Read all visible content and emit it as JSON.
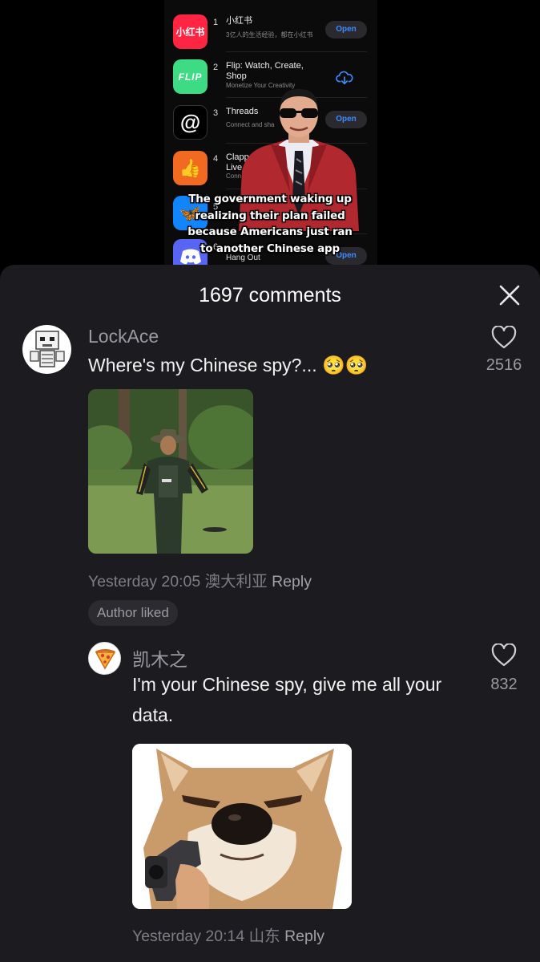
{
  "video": {
    "apps": [
      {
        "rank": "1",
        "name": "小红书",
        "subtitle": "3亿人的生活经验，都在小红书",
        "icon_text": "小红书",
        "icon_color": "#ff2442",
        "action": "Open"
      },
      {
        "rank": "2",
        "name": "Flip: Watch, Create, Shop",
        "subtitle": "Monetize Your Creativity",
        "icon_text": "FLIP",
        "icon_color": "#3ddc84",
        "action": "download-icon"
      },
      {
        "rank": "3",
        "name": "Threads",
        "subtitle": "Connect and sha",
        "icon_text": "@",
        "icon_color": "#000000",
        "action": "Open"
      },
      {
        "rank": "4",
        "name": "Clapp",
        "name2": "Live",
        "subtitle": "Conn",
        "icon_text": "👍",
        "icon_color": "#f26a22",
        "action": ""
      },
      {
        "rank": "5",
        "name": "",
        "subtitle": "",
        "icon_text": "🦋",
        "icon_color": "#1185fe",
        "action": ""
      },
      {
        "rank": "6",
        "name": "",
        "subtitle": "Hang Out",
        "icon_text": "discord",
        "icon_color": "#5865f2",
        "action": "Open"
      }
    ],
    "caption": "The government waking up realizing their plan failed because Americans just ran to another Chinese app"
  },
  "sheet": {
    "title": "1697 comments"
  },
  "comments": [
    {
      "username": "LockAce",
      "text": "Where's my Chinese spy?... 🥺🥺",
      "likes": "2516",
      "time": "Yesterday 20:05",
      "location": "澳大利亚",
      "reply": "Reply",
      "badge": "Author liked"
    },
    {
      "username": "凯木之",
      "text": "I'm your  Chinese spy, give me all your data.",
      "likes": "832",
      "time": "Yesterday 20:14",
      "location": "山东",
      "reply": "Reply"
    }
  ],
  "colors": {
    "sheet_bg": "#1c1c20",
    "accent_blue": "#3d8bff",
    "muted_text": "#7d7d84"
  }
}
